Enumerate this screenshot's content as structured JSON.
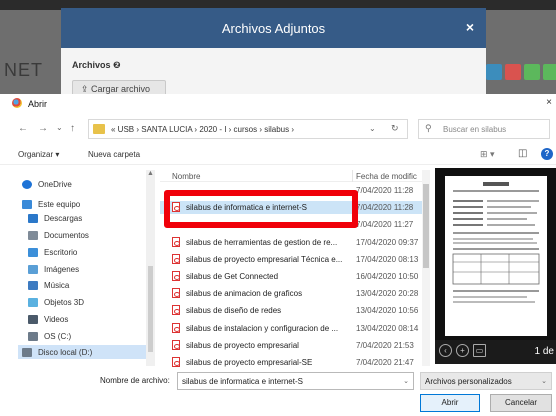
{
  "background": {
    "logo_text": "NET",
    "modal": {
      "title": "Archivos Adjuntos",
      "close": "×",
      "section_label": "Archivos ❷",
      "upload_button": "⇪ Cargar archivo"
    }
  },
  "dialog": {
    "title": "Abrir",
    "close": "×",
    "nav": {
      "back": "←",
      "forward": "→",
      "down": "⌄",
      "up": "↑"
    },
    "address_path": "«  USB  ›  SANTA LUCIA  ›  2020 - I  ›  cursos  ›  silabus  ›",
    "address_dropdown": "⌄",
    "refresh": "↻",
    "search_placeholder": "Buscar en silabus",
    "toolbar": {
      "organize": "Organizar ▾",
      "new_folder": "Nueva carpeta",
      "view": "⊞ ▾",
      "preview_pane": "◫",
      "help": "?"
    },
    "nav_items": [
      {
        "label": "OneDrive",
        "icon": "cloud-icon",
        "color": "#1e73d6"
      },
      {
        "label": "Este equipo",
        "icon": "computer-icon",
        "color": "#3a8ad8"
      },
      {
        "label": "Descargas",
        "icon": "download-icon",
        "color": "#2b78c9"
      },
      {
        "label": "Documentos",
        "icon": "documents-icon",
        "color": "#7f8b98"
      },
      {
        "label": "Escritorio",
        "icon": "desktop-icon",
        "color": "#3c8fd9"
      },
      {
        "label": "Imágenes",
        "icon": "pictures-icon",
        "color": "#5a9fd6"
      },
      {
        "label": "Música",
        "icon": "music-icon",
        "color": "#3d7bc1"
      },
      {
        "label": "Objetos 3D",
        "icon": "3d-objects-icon",
        "color": "#5ab1e0"
      },
      {
        "label": "Videos",
        "icon": "videos-icon",
        "color": "#4b5a6a"
      },
      {
        "label": "OS (C:)",
        "icon": "drive-icon",
        "color": "#6d7b8a"
      },
      {
        "label": "Disco local (D:)",
        "icon": "drive-icon",
        "color": "#6d7b8a"
      }
    ],
    "columns": {
      "name": "Nombre",
      "date": "Fecha de modific"
    },
    "files": [
      {
        "name": "",
        "date": "7/04/2020 11:28"
      },
      {
        "name": "silabus de informatica e internet-S",
        "date": "7/04/2020 11:28"
      },
      {
        "name": "",
        "date": "7/04/2020 11:27"
      },
      {
        "name": "silabus de herramientas de gestion de re...",
        "date": "17/04/2020 09:37"
      },
      {
        "name": "silabus de proyecto empresarial Técnica e...",
        "date": "17/04/2020 08:13"
      },
      {
        "name": "silabus de Get Connected",
        "date": "16/04/2020 10:50"
      },
      {
        "name": "silabus de animacion de graficos",
        "date": "13/04/2020 20:28"
      },
      {
        "name": "silabus de diseño de redes",
        "date": "13/04/2020 10:56"
      },
      {
        "name": "silabus de instalacion y configuracion de ...",
        "date": "13/04/2020 08:14"
      },
      {
        "name": "silabus de proyecto empresarial",
        "date": "7/04/2020 21:53"
      },
      {
        "name": "silabus de proyecto empresarial-SE",
        "date": "7/04/2020 21:47"
      }
    ],
    "preview": {
      "page_label": "1 de"
    },
    "filename_label": "Nombre de archivo:",
    "filename_value": "silabus de informatica e internet-S",
    "filetype_value": "Archivos personalizados",
    "open_button": "Abrir",
    "cancel_button": "Cancelar"
  },
  "colors": {
    "modal_header": "#365b87",
    "highlight": "#f0000a",
    "selection": "#cce4f7"
  }
}
